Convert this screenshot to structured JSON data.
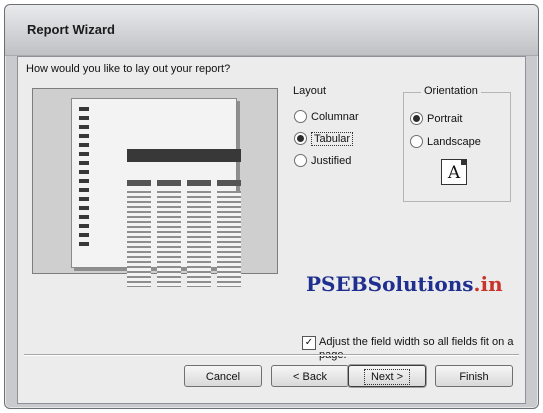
{
  "window": {
    "title": "Report Wizard"
  },
  "prompt": "How would you like to lay out your report?",
  "layout": {
    "group_label": "Layout",
    "options": [
      {
        "label": "Columnar",
        "selected": false
      },
      {
        "label": "Tabular",
        "selected": true
      },
      {
        "label": "Justified",
        "selected": false
      }
    ]
  },
  "orientation": {
    "group_label": "Orientation",
    "options": [
      {
        "label": "Portrait",
        "selected": true
      },
      {
        "label": "Landscape",
        "selected": false
      }
    ],
    "preview_letter": "A"
  },
  "watermark": {
    "main": "PSEBSolutions",
    "tld": ".in"
  },
  "adjust_width": {
    "checked": true,
    "mark": "✓",
    "label": "Adjust the field width so all fields fit on a page."
  },
  "buttons": {
    "cancel": "Cancel",
    "back": "< Back",
    "next": "Next >",
    "finish": "Finish"
  }
}
